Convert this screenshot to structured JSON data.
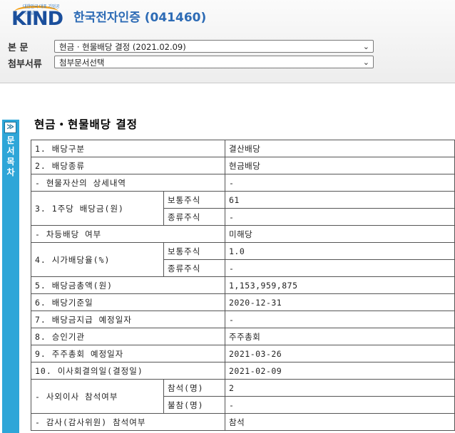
{
  "header": {
    "logo_tagline": "대한민국 대표 기업공시채널",
    "logo_word": "KIND",
    "company_title": "한국전자인증 (041460)",
    "main_label": "본 문",
    "attach_label": "첨부서류",
    "main_select_value": "현금 · 현물배당 결정 (2021.02.09)",
    "attach_select_value": "첨부문서선택"
  },
  "sidebar": {
    "toggle": "≫",
    "label_chars": [
      "문",
      "서",
      "목",
      "차"
    ]
  },
  "document": {
    "title": "현금・현물배당 결정",
    "rows": {
      "r1": {
        "label": "1. 배당구분",
        "value": "결산배당"
      },
      "r2": {
        "label": "2. 배당종류",
        "value": "현금배당"
      },
      "r3": {
        "label": "- 현물자산의 상세내역",
        "value": "-"
      },
      "r4": {
        "label": "3. 1주당 배당금(원)",
        "sub1": "보통주식",
        "val1": "61",
        "sub2": "종류주식",
        "val2": "-"
      },
      "r5": {
        "label": "- 차등배당 여부",
        "value": "미해당"
      },
      "r6": {
        "label": "4. 시가배당율(%)",
        "sub1": "보통주식",
        "val1": "1.0",
        "sub2": "종류주식",
        "val2": "-"
      },
      "r7": {
        "label": "5. 배당금총액(원)",
        "value": "1,153,959,875"
      },
      "r8": {
        "label": "6. 배당기준일",
        "value": "2020-12-31"
      },
      "r9": {
        "label": "7. 배당금지급 예정일자",
        "value": "-"
      },
      "r10": {
        "label": "8. 승인기관",
        "value": "주주총회"
      },
      "r11": {
        "label": "9. 주주총회 예정일자",
        "value": "2021-03-26"
      },
      "r12": {
        "label": "10. 이사회결의일(결정일)",
        "value": "2021-02-09"
      },
      "r13": {
        "label": "- 사외이사 참석여부",
        "sub1": "참석(명)",
        "val1": "2",
        "sub2": "불참(명)",
        "val2": "-"
      },
      "r14": {
        "label": "- 감사(감사위원) 참석여부",
        "value": "참석"
      }
    }
  }
}
